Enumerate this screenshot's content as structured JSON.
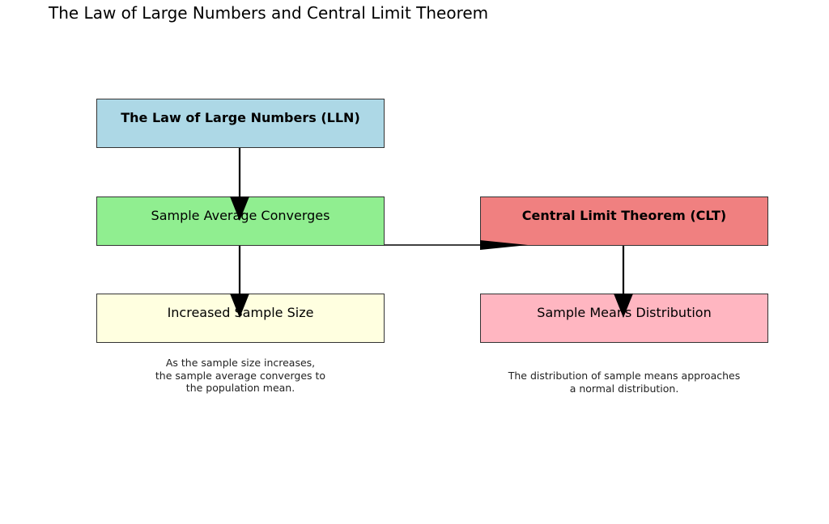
{
  "title": "The Law of Large Numbers and Central Limit Theorem",
  "nodes": {
    "lln": {
      "label": "The Law of Large Numbers (LLN)",
      "color": "#add8e6"
    },
    "sample_avg": {
      "label": "Sample Average Converges",
      "color": "#90ee90"
    },
    "increased_size": {
      "label": "Increased Sample Size",
      "color": "#ffffe0"
    },
    "clt": {
      "label": "Central Limit Theorem (CLT)",
      "color": "#f08080"
    },
    "sample_means": {
      "label": "Sample Means Distribution",
      "color": "#ffb6c1"
    }
  },
  "edges": [
    {
      "from": "lln",
      "to": "sample_avg"
    },
    {
      "from": "sample_avg",
      "to": "increased_size"
    },
    {
      "from": "sample_avg",
      "to": "clt"
    },
    {
      "from": "clt",
      "to": "sample_means"
    }
  ],
  "notes": {
    "lln_note": "As the sample size increases,\nthe sample average converges to\nthe population mean.",
    "clt_note": "The distribution of sample means approaches\na normal distribution."
  }
}
